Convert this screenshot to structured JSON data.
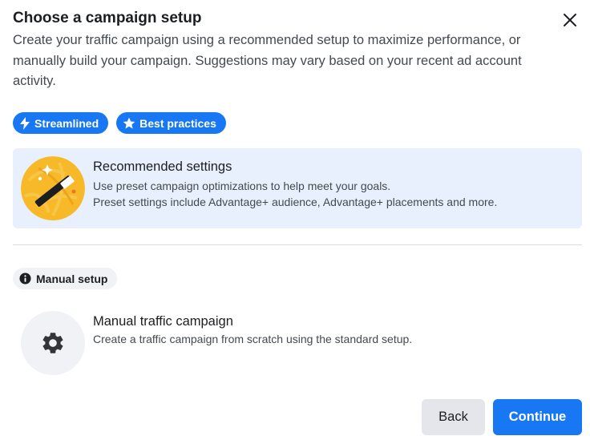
{
  "dialog": {
    "title": "Choose a campaign setup",
    "subtitle": "Create your traffic campaign using a recommended setup to maximize performance, or manually build your campaign. Suggestions may vary based on your recent ad account activity.",
    "close_icon": "close-icon"
  },
  "badges": [
    {
      "label": "Streamlined",
      "icon": "lightning-icon"
    },
    {
      "label": "Best practices",
      "icon": "star-icon"
    }
  ],
  "recommended": {
    "title": "Recommended settings",
    "line1": "Use preset campaign optimizations to help meet your goals.",
    "line2": "Preset settings include Advantage+ audience, Advantage+ placements and more.",
    "icon": "magic-wand-icon"
  },
  "manual_section": {
    "badge_label": "Manual setup",
    "badge_icon": "info-icon"
  },
  "manual": {
    "title": "Manual traffic campaign",
    "line1": "Create a traffic campaign from scratch using the standard setup.",
    "icon": "gear-icon"
  },
  "footer": {
    "back_label": "Back",
    "continue_label": "Continue"
  },
  "colors": {
    "primary": "#1877f2",
    "selected_card_bg": "#e7f0fc",
    "secondary_button_bg": "#e4e6eb",
    "wand_circle": "#f7b928"
  }
}
